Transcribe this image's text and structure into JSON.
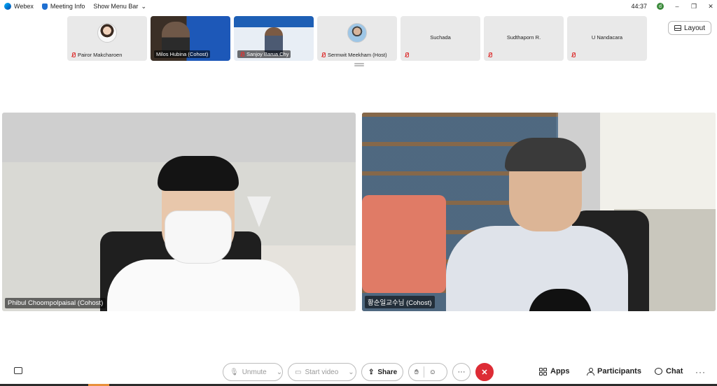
{
  "titlebar": {
    "app_name": "Webex",
    "meeting_info": "Meeting Info",
    "show_menu_bar": "Show Menu Bar",
    "timer": "44:37",
    "user_initial": "d",
    "minimize": "–",
    "restore": "❐",
    "close": "✕"
  },
  "participants_strip": [
    {
      "name": "Pairor Makcharoen",
      "type": "avatar",
      "muted": true
    },
    {
      "name": "Milos Hubina (Cohost)",
      "type": "video",
      "muted": false
    },
    {
      "name": "Sanjoy Barua Chy",
      "type": "video",
      "muted": true
    },
    {
      "name": "Sermwit Meekham (Host)",
      "type": "avatar",
      "muted": true
    },
    {
      "name": "Suchada",
      "type": "name",
      "muted": true
    },
    {
      "name": "Sudthaporn R.",
      "type": "name",
      "muted": true
    },
    {
      "name": "U Nandacara",
      "type": "name",
      "muted": true
    }
  ],
  "layout_label": "Layout",
  "main": {
    "left_name": "Phibul Choompolpaisal (Cohost)",
    "right_name": "황순일교수님 (Cohost)"
  },
  "toolbar": {
    "unmute": "Unmute",
    "start_video": "Start video",
    "share": "Share",
    "more": "···",
    "end": "✕",
    "apps": "Apps",
    "participants": "Participants",
    "chat": "Chat",
    "overflow": "···"
  },
  "colors": {
    "end_call": "#dd2c35",
    "muted_icon": "#dd3333"
  }
}
